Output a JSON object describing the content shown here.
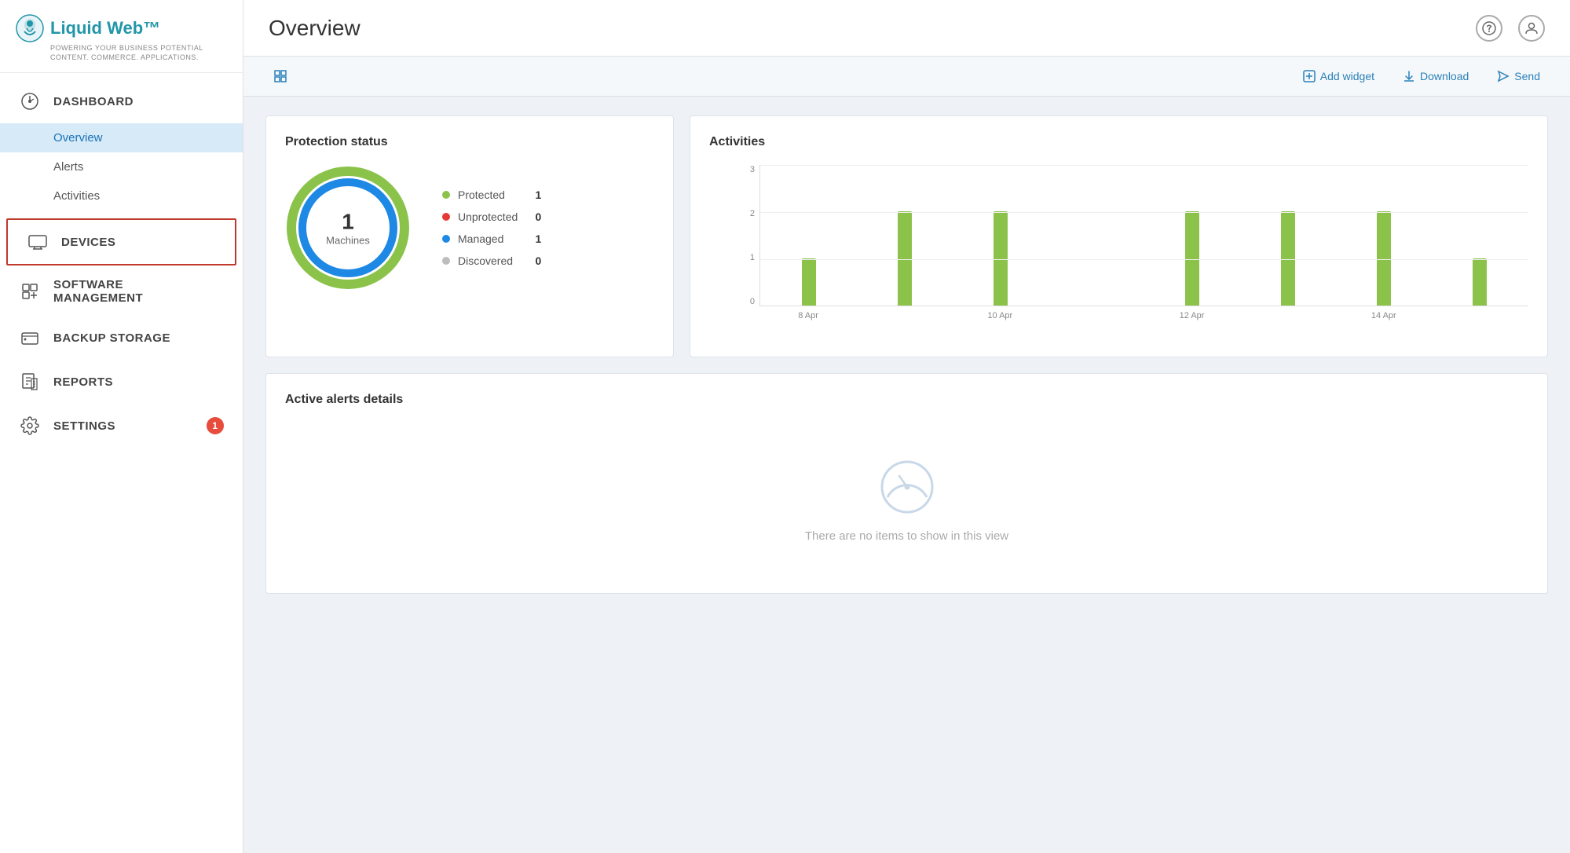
{
  "logo": {
    "brand": "Liquid Web™",
    "tagline1": "POWERING YOUR BUSINESS POTENTIAL",
    "tagline2": "Content. Commerce. Applications."
  },
  "sidebar": {
    "sections": [
      {
        "id": "dashboard",
        "label": "DASHBOARD",
        "icon": "dashboard-icon",
        "active": false,
        "sub_items": [
          {
            "id": "overview",
            "label": "Overview",
            "active": true
          },
          {
            "id": "alerts",
            "label": "Alerts",
            "active": false
          },
          {
            "id": "activities",
            "label": "Activities",
            "active": false
          }
        ]
      },
      {
        "id": "devices",
        "label": "DEVICES",
        "icon": "devices-icon",
        "active": true,
        "sub_items": []
      },
      {
        "id": "software-management",
        "label": "SOFTWARE MANAGEMENT",
        "icon": "software-icon",
        "active": false,
        "sub_items": []
      },
      {
        "id": "backup-storage",
        "label": "BACKUP STORAGE",
        "icon": "backup-icon",
        "active": false,
        "sub_items": []
      },
      {
        "id": "reports",
        "label": "REPORTS",
        "icon": "reports-icon",
        "active": false,
        "sub_items": []
      },
      {
        "id": "settings",
        "label": "SETTINGS",
        "icon": "settings-icon",
        "active": false,
        "badge": "1",
        "sub_items": []
      }
    ]
  },
  "header": {
    "page_title": "Overview",
    "help_icon": "help-icon",
    "user_icon": "user-icon"
  },
  "toolbar": {
    "expand_icon": "expand-icon",
    "add_widget_label": "Add widget",
    "download_label": "Download",
    "send_label": "Send"
  },
  "protection_status": {
    "title": "Protection status",
    "donut": {
      "center_number": "1",
      "center_label": "Machines"
    },
    "legend": [
      {
        "label": "Protected",
        "value": "1",
        "color": "#8bc34a"
      },
      {
        "label": "Unprotected",
        "value": "0",
        "color": "#e53935"
      },
      {
        "label": "Managed",
        "value": "1",
        "color": "#1e88e5"
      },
      {
        "label": "Discovered",
        "value": "0",
        "color": "#bdbdbd"
      }
    ]
  },
  "activities": {
    "title": "Activities",
    "y_labels": [
      "3",
      "2",
      "1",
      "0"
    ],
    "bars": [
      {
        "label": "8 Apr",
        "height_pct": 33
      },
      {
        "label": "",
        "height_pct": 67
      },
      {
        "label": "10 Apr",
        "height_pct": 67
      },
      {
        "label": "",
        "height_pct": 0
      },
      {
        "label": "12 Apr",
        "height_pct": 67
      },
      {
        "label": "",
        "height_pct": 67
      },
      {
        "label": "14 Apr",
        "height_pct": 67
      },
      {
        "label": "",
        "height_pct": 33
      }
    ],
    "x_labels": [
      "8 Apr",
      "",
      "10 Apr",
      "",
      "12 Apr",
      "",
      "14 Apr",
      ""
    ]
  },
  "active_alerts": {
    "title": "Active alerts details",
    "empty_text": "There are no items to show in this view"
  }
}
